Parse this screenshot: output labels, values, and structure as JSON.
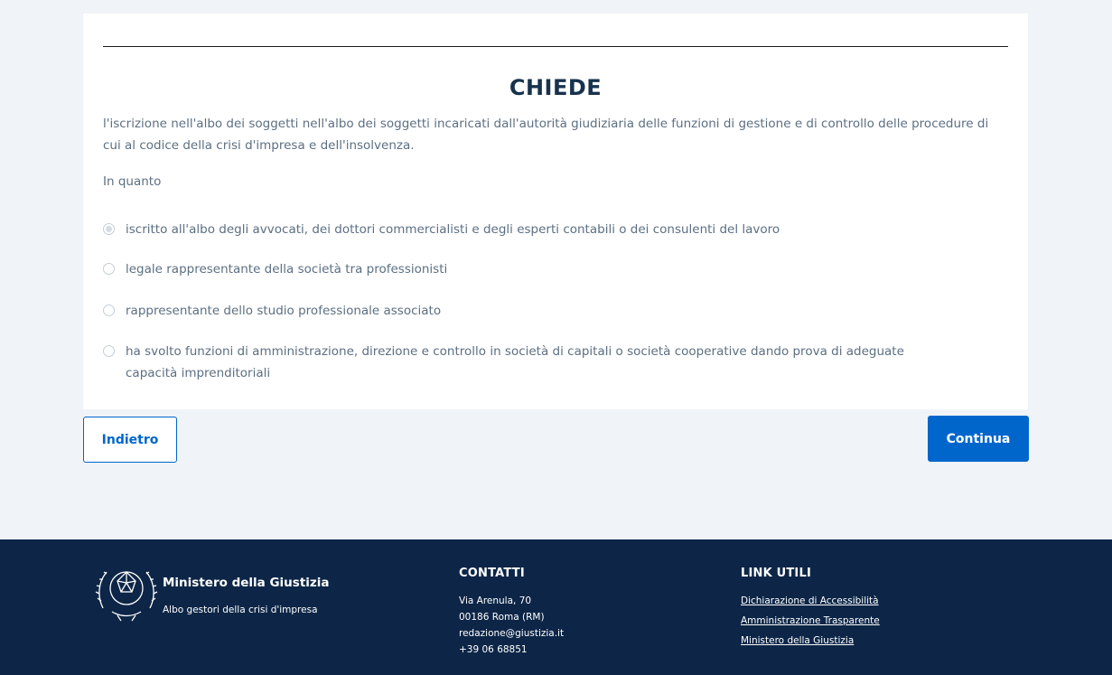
{
  "form": {
    "title": "CHIEDE",
    "body": "l'iscrizione nell'albo dei soggetti nell'albo dei soggetti incaricati dall'autorità giudiziaria delle funzioni di gestione e di controllo delle procedure di cui al codice della crisi d'impresa e dell'insolvenza.",
    "in_quanto": "In quanto",
    "options": [
      {
        "label": "iscritto all'albo degli avvocati, dei dottori commercialisti e degli esperti contabili o dei consulenti del lavoro",
        "selected": true
      },
      {
        "label": "legale rappresentante della società tra professionisti",
        "selected": false
      },
      {
        "label": "rappresentante dello studio professionale associato",
        "selected": false
      },
      {
        "label": "ha svolto funzioni di amministrazione, direzione e controllo in società di capitali o società cooperative dando prova di adeguate capacità imprenditoriali",
        "selected": false
      }
    ]
  },
  "actions": {
    "back_label": "Indietro",
    "continue_label": "Continua"
  },
  "footer": {
    "brand_title": "Ministero della Giustizia",
    "brand_subtitle": "Albo gestori della crisi d'impresa",
    "contacts_title": "CONTATTI",
    "contacts": [
      "Via Arenula, 70",
      "00186 Roma (RM)",
      "redazione@giustizia.it",
      "+39 06 68851"
    ],
    "links_title": "LINK UTILI",
    "links": [
      "Dichiarazione di Accessibilità",
      "Amministrazione Trasparente",
      "Ministero della Giustizia"
    ]
  },
  "colors": {
    "primary": "#0066cc",
    "footer_bg": "#0d2647",
    "page_bg": "#f0f4f8"
  }
}
